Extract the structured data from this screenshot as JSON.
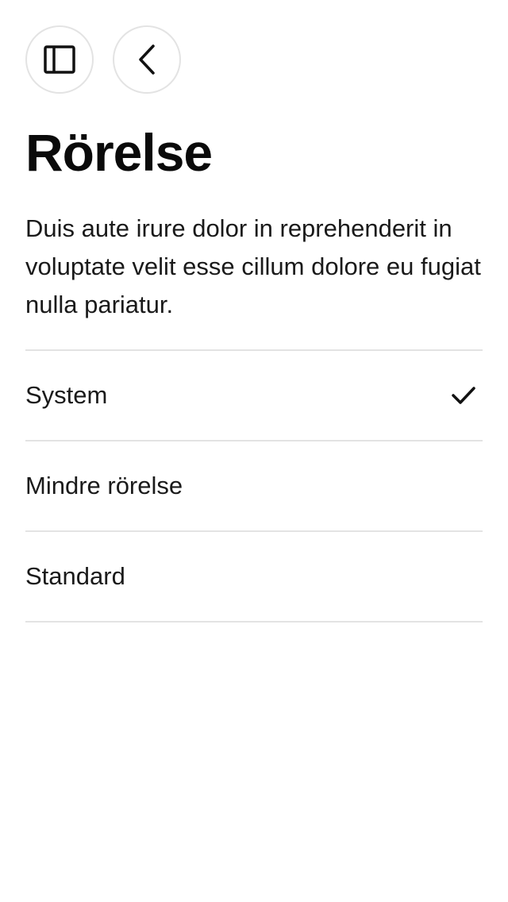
{
  "header": {
    "sidebar_button_icon": "sidebar-panel-icon",
    "back_button_icon": "chevron-left-icon"
  },
  "page": {
    "title": "Rörelse",
    "description": "Duis aute irure dolor in reprehenderit in voluptate velit esse cillum dolore eu fugiat nulla pariatur."
  },
  "options": [
    {
      "label": "System",
      "selected": true
    },
    {
      "label": "Mindre rörelse",
      "selected": false
    },
    {
      "label": "Standard",
      "selected": false
    }
  ],
  "colors": {
    "text": "#111111",
    "divider": "#e3e3e3",
    "background": "#ffffff"
  }
}
